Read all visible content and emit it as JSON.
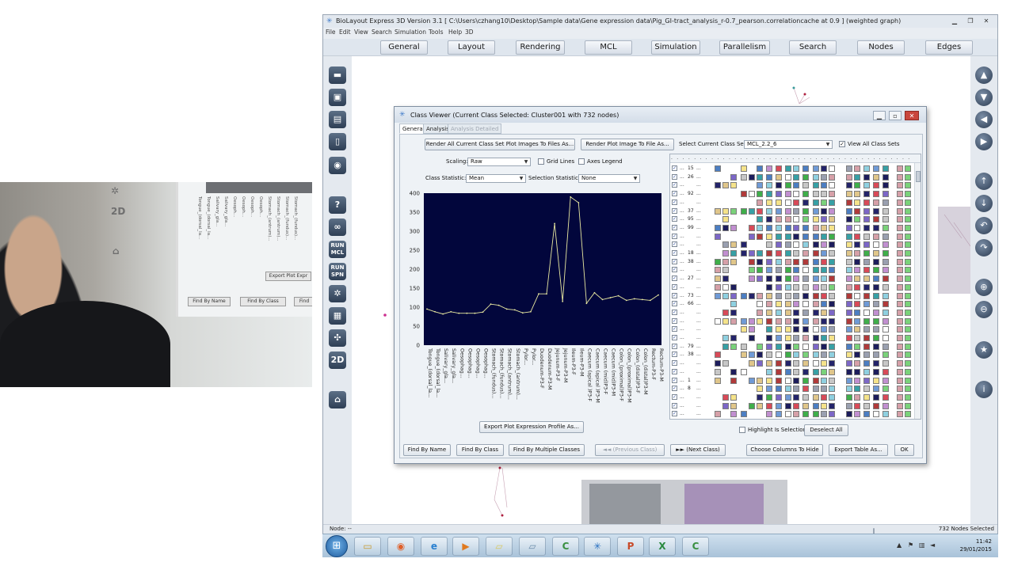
{
  "app": {
    "title": "BioLayout Express 3D Version 3.1  [ C:\\Users\\czhang10\\Desktop\\Sample data\\Gene expression data\\Pig_GI-tract_analysis_r-0.7_pearson.correlationcache at 0.9 ] (weighted graph)",
    "menu": [
      "File",
      "Edit",
      "View",
      "Search",
      "Simulation",
      "Tools",
      "Help",
      "3D"
    ],
    "toolbar_tabs": [
      "General",
      "Layout",
      "Rendering",
      "MCL",
      "Simulation",
      "Parallelism",
      "Search",
      "Nodes",
      "Edges"
    ],
    "left_tools": [
      "folder-open",
      "folder-image",
      "save",
      "document",
      "camera",
      "help",
      "binoculars",
      "RUN MCL",
      "RUN SPN",
      "gear",
      "film",
      "network",
      "2D",
      "home"
    ],
    "right_tools": [
      "arrow-up",
      "arrow-down",
      "arrow-left",
      "arrow-right",
      "rotate-up",
      "rotate-down",
      "rotate-left",
      "rotate-right",
      "zoom-in",
      "zoom-out",
      "star",
      "info"
    ],
    "status_left": "Node: --",
    "status_right": "732 Nodes Selected"
  },
  "dialog": {
    "title": "Class Viewer (Current Class Selected: Cluster001 with 732 nodes)",
    "tabs": [
      "General",
      "Analysis",
      "Analysis Detailed"
    ],
    "render_all_button": "Render All Current Class Set Plot Images To Files As...",
    "render_plot_button": "Render Plot Image To File As...",
    "select_class_set_label": "Select Current Class Set:",
    "class_set_value": "MCL_2.2_6",
    "view_all_label": "View All Class Sets",
    "scaling_label": "Scaling:",
    "scaling_value": "Raw",
    "grid_lines_label": "Grid Lines",
    "axes_legend_label": "Axes Legend",
    "class_statistic_label": "Class Statistic:",
    "class_statistic_value": "Mean",
    "selection_statistic_label": "Selection Statistic:",
    "selection_statistic_value": "None",
    "export_profile_button": "Export Plot Expression Profile As...",
    "highlight_label": "Highlight Is Selection",
    "deselect_all_button": "Deselect All",
    "find_by_name": "Find By Name",
    "find_by_class": "Find By Class",
    "find_by_multiple": "Find By Multiple Classes",
    "previous_class": "◄◄ (Previous Class)",
    "next_class": "►► (Next Class)",
    "choose_columns": "Choose Columns To Hide",
    "export_table": "Export Table As...",
    "ok": "OK",
    "grid_row_numbers": [
      "15",
      "26",
      "",
      "92",
      "",
      "37",
      "95",
      "99",
      "",
      "",
      "18",
      "38",
      "",
      "27",
      "",
      "73",
      "66",
      "",
      "",
      "",
      "",
      "79",
      "38",
      "",
      "",
      "1",
      "8",
      "",
      "",
      ""
    ]
  },
  "webcam": {
    "mini_buttons": [
      "Export Plot Expr",
      "Find By Name",
      "Find By Class",
      "Find"
    ],
    "mini_tools": [
      "2D"
    ],
    "mini_labels": [
      "Tongue_(dorsal_la...",
      "Tongue_(dorsal_la...",
      "Salivary_gla...",
      "Salivary_gla...",
      "Oesoph...",
      "Oesoph...",
      "Oesoph...",
      "Oesoph...",
      "Stomach_(antrum)...",
      "Stomach_(antrum)...",
      "Stomach_(fundus)...",
      "Stomach_(fundus)..."
    ]
  },
  "taskbar": {
    "apps": [
      "explorer",
      "firefox",
      "ie",
      "media",
      "folder2",
      "folder3",
      "camtasia",
      "biolayout",
      "powerpoint",
      "excel",
      "camtasia2"
    ],
    "time": "11:42",
    "date": "29/01/2015"
  },
  "chart_data": {
    "type": "line",
    "title": "",
    "xlabel": "",
    "ylabel": "",
    "ylim": [
      0,
      400
    ],
    "yticks": [
      0,
      50,
      100,
      150,
      200,
      250,
      300,
      350,
      400
    ],
    "grid": false,
    "background": "#02063c",
    "line_color": "#e8e8a0",
    "categories": [
      "Tongue_(dorsal_la...",
      "Tongue_(dorsal_la...",
      "Salivary_gla...",
      "Salivary_gla...",
      "Oesophag...",
      "Oesophag...",
      "Oesophag...",
      "Oesophag...",
      "Stomach_(fundus)...",
      "Stomach_(fundus)...",
      "Stomach_(antrum)...",
      "Stomach_(antrum)...",
      "Pylor...",
      "Pylor...",
      "Duodenum-P3-F",
      "Duodenum-P3-M",
      "Jejunum-P3-F",
      "Jejunum-P3-M",
      "Ileum-P3-F",
      "Ileum-P3-M",
      "Caecum (apical )P3-F",
      "Caecum (apical )P3-M",
      "Caecum (mid)P3-F",
      "Caecum (mid)P3-M",
      "Colon_(proximal)P3-F",
      "Colon_(proximal)P3-M",
      "Colon_(distal)P3-F",
      "Colon_(distal)P3-M",
      "Rectum-P3-F",
      "Rectum-P3-M"
    ],
    "series": [
      {
        "values": [
          95,
          88,
          82,
          88,
          84,
          84,
          84,
          87,
          108,
          105,
          95,
          93,
          85,
          88,
          135,
          135,
          320,
          115,
          390,
          375,
          110,
          138,
          120,
          125,
          130,
          118,
          122,
          120,
          118,
          132
        ]
      }
    ]
  }
}
